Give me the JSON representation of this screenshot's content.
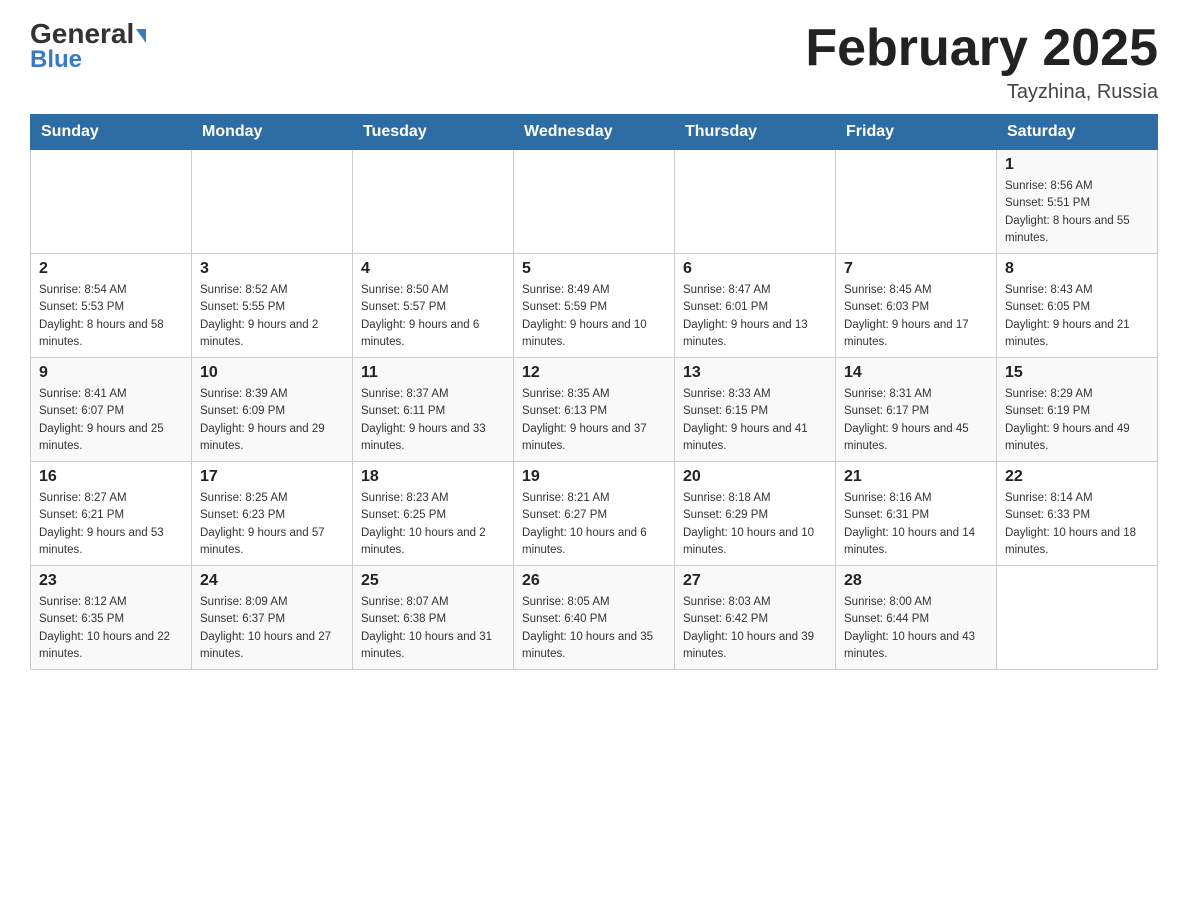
{
  "header": {
    "logo_general": "General",
    "logo_blue": "Blue",
    "month_title": "February 2025",
    "location": "Tayzhina, Russia"
  },
  "days_of_week": [
    "Sunday",
    "Monday",
    "Tuesday",
    "Wednesday",
    "Thursday",
    "Friday",
    "Saturday"
  ],
  "weeks": [
    [
      {
        "day": "",
        "sunrise": "",
        "sunset": "",
        "daylight": ""
      },
      {
        "day": "",
        "sunrise": "",
        "sunset": "",
        "daylight": ""
      },
      {
        "day": "",
        "sunrise": "",
        "sunset": "",
        "daylight": ""
      },
      {
        "day": "",
        "sunrise": "",
        "sunset": "",
        "daylight": ""
      },
      {
        "day": "",
        "sunrise": "",
        "sunset": "",
        "daylight": ""
      },
      {
        "day": "",
        "sunrise": "",
        "sunset": "",
        "daylight": ""
      },
      {
        "day": "1",
        "sunrise": "Sunrise: 8:56 AM",
        "sunset": "Sunset: 5:51 PM",
        "daylight": "Daylight: 8 hours and 55 minutes."
      }
    ],
    [
      {
        "day": "2",
        "sunrise": "Sunrise: 8:54 AM",
        "sunset": "Sunset: 5:53 PM",
        "daylight": "Daylight: 8 hours and 58 minutes."
      },
      {
        "day": "3",
        "sunrise": "Sunrise: 8:52 AM",
        "sunset": "Sunset: 5:55 PM",
        "daylight": "Daylight: 9 hours and 2 minutes."
      },
      {
        "day": "4",
        "sunrise": "Sunrise: 8:50 AM",
        "sunset": "Sunset: 5:57 PM",
        "daylight": "Daylight: 9 hours and 6 minutes."
      },
      {
        "day": "5",
        "sunrise": "Sunrise: 8:49 AM",
        "sunset": "Sunset: 5:59 PM",
        "daylight": "Daylight: 9 hours and 10 minutes."
      },
      {
        "day": "6",
        "sunrise": "Sunrise: 8:47 AM",
        "sunset": "Sunset: 6:01 PM",
        "daylight": "Daylight: 9 hours and 13 minutes."
      },
      {
        "day": "7",
        "sunrise": "Sunrise: 8:45 AM",
        "sunset": "Sunset: 6:03 PM",
        "daylight": "Daylight: 9 hours and 17 minutes."
      },
      {
        "day": "8",
        "sunrise": "Sunrise: 8:43 AM",
        "sunset": "Sunset: 6:05 PM",
        "daylight": "Daylight: 9 hours and 21 minutes."
      }
    ],
    [
      {
        "day": "9",
        "sunrise": "Sunrise: 8:41 AM",
        "sunset": "Sunset: 6:07 PM",
        "daylight": "Daylight: 9 hours and 25 minutes."
      },
      {
        "day": "10",
        "sunrise": "Sunrise: 8:39 AM",
        "sunset": "Sunset: 6:09 PM",
        "daylight": "Daylight: 9 hours and 29 minutes."
      },
      {
        "day": "11",
        "sunrise": "Sunrise: 8:37 AM",
        "sunset": "Sunset: 6:11 PM",
        "daylight": "Daylight: 9 hours and 33 minutes."
      },
      {
        "day": "12",
        "sunrise": "Sunrise: 8:35 AM",
        "sunset": "Sunset: 6:13 PM",
        "daylight": "Daylight: 9 hours and 37 minutes."
      },
      {
        "day": "13",
        "sunrise": "Sunrise: 8:33 AM",
        "sunset": "Sunset: 6:15 PM",
        "daylight": "Daylight: 9 hours and 41 minutes."
      },
      {
        "day": "14",
        "sunrise": "Sunrise: 8:31 AM",
        "sunset": "Sunset: 6:17 PM",
        "daylight": "Daylight: 9 hours and 45 minutes."
      },
      {
        "day": "15",
        "sunrise": "Sunrise: 8:29 AM",
        "sunset": "Sunset: 6:19 PM",
        "daylight": "Daylight: 9 hours and 49 minutes."
      }
    ],
    [
      {
        "day": "16",
        "sunrise": "Sunrise: 8:27 AM",
        "sunset": "Sunset: 6:21 PM",
        "daylight": "Daylight: 9 hours and 53 minutes."
      },
      {
        "day": "17",
        "sunrise": "Sunrise: 8:25 AM",
        "sunset": "Sunset: 6:23 PM",
        "daylight": "Daylight: 9 hours and 57 minutes."
      },
      {
        "day": "18",
        "sunrise": "Sunrise: 8:23 AM",
        "sunset": "Sunset: 6:25 PM",
        "daylight": "Daylight: 10 hours and 2 minutes."
      },
      {
        "day": "19",
        "sunrise": "Sunrise: 8:21 AM",
        "sunset": "Sunset: 6:27 PM",
        "daylight": "Daylight: 10 hours and 6 minutes."
      },
      {
        "day": "20",
        "sunrise": "Sunrise: 8:18 AM",
        "sunset": "Sunset: 6:29 PM",
        "daylight": "Daylight: 10 hours and 10 minutes."
      },
      {
        "day": "21",
        "sunrise": "Sunrise: 8:16 AM",
        "sunset": "Sunset: 6:31 PM",
        "daylight": "Daylight: 10 hours and 14 minutes."
      },
      {
        "day": "22",
        "sunrise": "Sunrise: 8:14 AM",
        "sunset": "Sunset: 6:33 PM",
        "daylight": "Daylight: 10 hours and 18 minutes."
      }
    ],
    [
      {
        "day": "23",
        "sunrise": "Sunrise: 8:12 AM",
        "sunset": "Sunset: 6:35 PM",
        "daylight": "Daylight: 10 hours and 22 minutes."
      },
      {
        "day": "24",
        "sunrise": "Sunrise: 8:09 AM",
        "sunset": "Sunset: 6:37 PM",
        "daylight": "Daylight: 10 hours and 27 minutes."
      },
      {
        "day": "25",
        "sunrise": "Sunrise: 8:07 AM",
        "sunset": "Sunset: 6:38 PM",
        "daylight": "Daylight: 10 hours and 31 minutes."
      },
      {
        "day": "26",
        "sunrise": "Sunrise: 8:05 AM",
        "sunset": "Sunset: 6:40 PM",
        "daylight": "Daylight: 10 hours and 35 minutes."
      },
      {
        "day": "27",
        "sunrise": "Sunrise: 8:03 AM",
        "sunset": "Sunset: 6:42 PM",
        "daylight": "Daylight: 10 hours and 39 minutes."
      },
      {
        "day": "28",
        "sunrise": "Sunrise: 8:00 AM",
        "sunset": "Sunset: 6:44 PM",
        "daylight": "Daylight: 10 hours and 43 minutes."
      },
      {
        "day": "",
        "sunrise": "",
        "sunset": "",
        "daylight": ""
      }
    ]
  ]
}
